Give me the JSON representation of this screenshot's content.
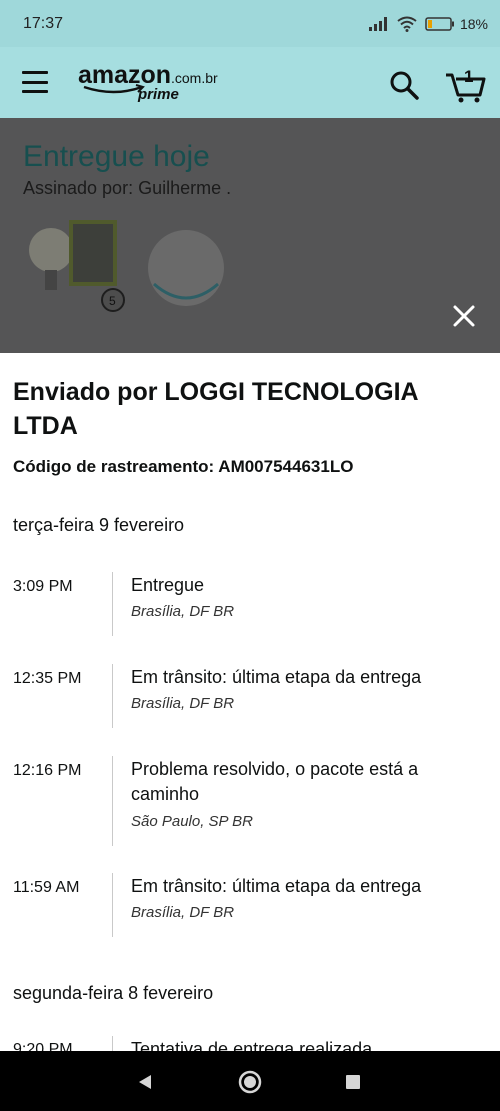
{
  "status_bar": {
    "time": "17:37",
    "battery": "18%"
  },
  "header": {
    "logo_text": "amazon",
    "logo_domain": ".com.br",
    "logo_prime": "prime",
    "cart_count": "1"
  },
  "background": {
    "title": "Entregue hoje",
    "signed_by": "Assinado por: Guilherme .",
    "product_badge": "5"
  },
  "shipment": {
    "carrier": "Enviado por LOGGI TECNOLOGIA LTDA",
    "tracking": "Código de rastreamento: AM007544631LO",
    "days": [
      {
        "date": "terça-feira 9 fevereiro",
        "events": [
          {
            "time": "3:09 PM",
            "status": "Entregue",
            "location": "Brasília, DF BR"
          },
          {
            "time": "12:35 PM",
            "status": "Em trânsito: última etapa da entrega",
            "location": "Brasília, DF BR"
          },
          {
            "time": "12:16 PM",
            "status": "Problema resolvido, o pacote está a caminho",
            "location": "São Paulo, SP BR"
          },
          {
            "time": "11:59 AM",
            "status": "Em trânsito: última etapa da entrega",
            "location": "Brasília, DF BR"
          }
        ]
      },
      {
        "date": "segunda-feira 8 fevereiro",
        "events": [
          {
            "time": "9:20 PM",
            "status": "Tentativa de entrega realizada"
          }
        ]
      }
    ]
  },
  "colors": {
    "header_bg": "#a6dee0",
    "overlay": "#555556",
    "title_teal": "#174f4f"
  }
}
